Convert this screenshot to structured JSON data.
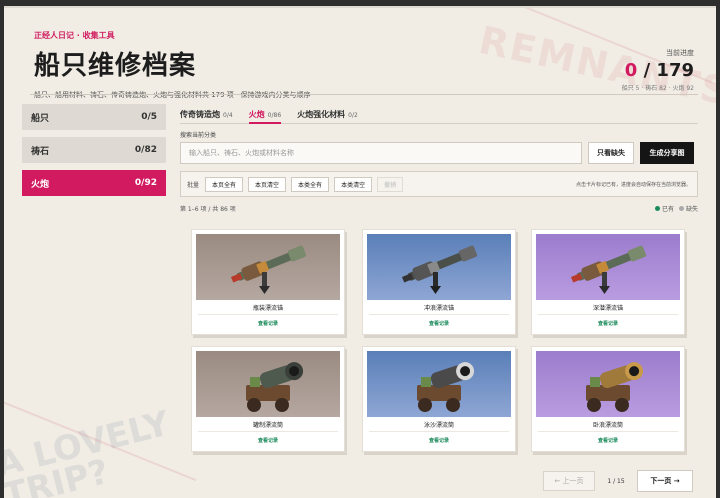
{
  "header": {
    "crumb": "正经人日记 · 收集工具",
    "title": "船只维修档案",
    "subtitle": "船只、船用材料、祷石、传奇铸造炮、火炮与强化材料共 179 项 · 保持游戏内分类与顺序",
    "progress_label": "当前进度",
    "progress_current": "0",
    "progress_total": "/ 179",
    "progress_sub": "船只 5 · 祷石 82 · 火炮 92"
  },
  "background": {
    "word1": "REMNANTS",
    "word2": "A LOVELY",
    "word3": "TRIP?"
  },
  "sidebar": {
    "items": [
      {
        "label": "船只",
        "count": "0/5"
      },
      {
        "label": "祷石",
        "count": "0/82"
      },
      {
        "label": "火炮",
        "count": "0/92"
      }
    ]
  },
  "tabs": [
    {
      "label": "传奇铸造炮",
      "count": "0/4"
    },
    {
      "label": "火炮",
      "count": "0/86"
    },
    {
      "label": "火炮强化材料",
      "count": "0/2"
    }
  ],
  "search": {
    "label": "搜索当前分类",
    "placeholder": "输入船只、祷石、火炮或材料名称",
    "missing_btn": "只看缺失",
    "generate_btn": "生成分享图"
  },
  "batch": {
    "label": "批量",
    "buttons": [
      "本页全有",
      "本页清空",
      "本类全有",
      "本类清空",
      "撤销"
    ],
    "hint": "点击卡片标记已有，进度会自动保存在当前浏览器。"
  },
  "count_text": "第 1–6 项 / 共 86 项",
  "legend": {
    "have": "已有",
    "missing": "缺失",
    "have_color": "#1a8a5a",
    "missing_color": "#aaaaaa"
  },
  "cards": [
    {
      "name": "瓶装漂流锚",
      "link": "查看记录",
      "icon": "harpoon-cannon-icon"
    },
    {
      "name": "冲浪漂流锚",
      "link": "查看记录",
      "icon": "harpoon-cannon-icon"
    },
    {
      "name": "深潜漂流锚",
      "link": "查看记录",
      "icon": "harpoon-cannon-icon"
    },
    {
      "name": "罐制漂流筒",
      "link": "查看记录",
      "icon": "wheeled-cannon-icon"
    },
    {
      "name": "泳沙漂流筒",
      "link": "查看记录",
      "icon": "wheeled-cannon-icon"
    },
    {
      "name": "卧浪漂流筒",
      "link": "查看记录",
      "icon": "wheeled-cannon-icon"
    }
  ],
  "pager": {
    "prev": "← 上一页",
    "info": "1 / 15",
    "next": "下一页 →"
  },
  "colors": {
    "accent": "#d11a5f",
    "dark": "#151515",
    "link": "#1a8a5a"
  }
}
